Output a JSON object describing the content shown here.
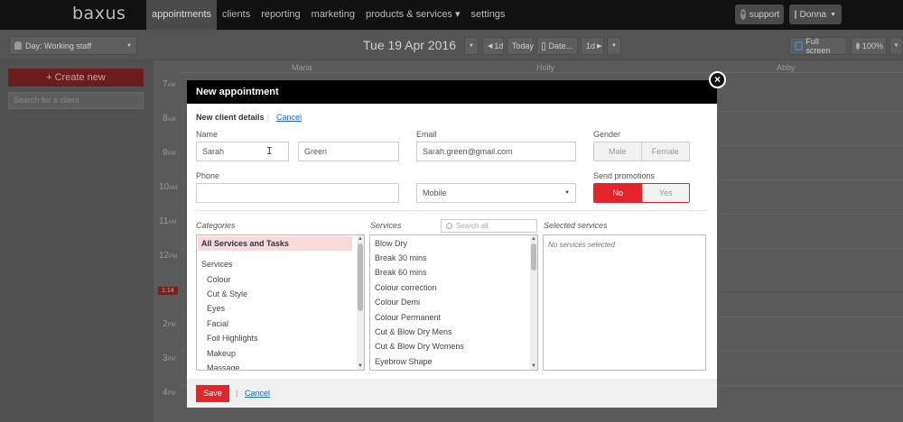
{
  "nav": {
    "logo": "baxus",
    "items": [
      "appointments",
      "clients",
      "reporting",
      "marketing",
      "products & services ▾",
      "settings"
    ],
    "support": "support",
    "user": "Donna"
  },
  "toolbar": {
    "staff_view": "Day: Working staff",
    "date": "Tue 19 Apr 2016",
    "prev": "1d",
    "today": "Today",
    "date_btn": "Date...",
    "next": "1d",
    "fullscreen": "Full screen",
    "zoom": "100%"
  },
  "left": {
    "create": "+ Create new",
    "search_placeholder": "Search for a client"
  },
  "calendar": {
    "columns": [
      "Maria",
      "Holly",
      "Abby"
    ],
    "times": [
      {
        "h": "7",
        "p": "AM"
      },
      {
        "h": "8",
        "p": "AM"
      },
      {
        "h": "9",
        "p": "AM"
      },
      {
        "h": "10",
        "p": "AM"
      },
      {
        "h": "11",
        "p": "AM"
      },
      {
        "h": "12",
        "p": "PM"
      },
      {
        "h": "2",
        "p": "PM"
      },
      {
        "h": "3",
        "p": "PM"
      },
      {
        "h": "4",
        "p": "PM"
      }
    ],
    "now": "1:14"
  },
  "modal": {
    "title": "New appointment",
    "section": "New client details",
    "cancel_top": "Cancel",
    "name_label": "Name",
    "first_name": "Sarah",
    "last_name": "Green",
    "email_label": "Email",
    "email": "Sarah.green@gmail.com",
    "gender_label": "Gender",
    "male": "Male",
    "female": "Female",
    "phone_label": "Phone",
    "phone": "",
    "phone_type": "Mobile",
    "promo_label": "Send promotions",
    "no": "No",
    "yes": "Yes",
    "categories_label": "Categories",
    "categories": [
      "All Services and Tasks",
      "Services",
      "Colour",
      "Cut & Style",
      "Eyes",
      "Facial",
      "Foil Highlights",
      "Makeup",
      "Massage"
    ],
    "services_label": "Services",
    "services_search": "Search all",
    "services": [
      "Blow Dry",
      "Break 30 mins",
      "Break 60 mins",
      "Colour correction",
      "Colour Demi",
      "Colour Permanent",
      "Cut & Blow Dry Mens",
      "Cut & Blow Dry Womens",
      "Eyebrow Shape"
    ],
    "selected_label": "Selected services",
    "selected_empty": "No services selected",
    "save": "Save",
    "cancel": "Cancel"
  }
}
